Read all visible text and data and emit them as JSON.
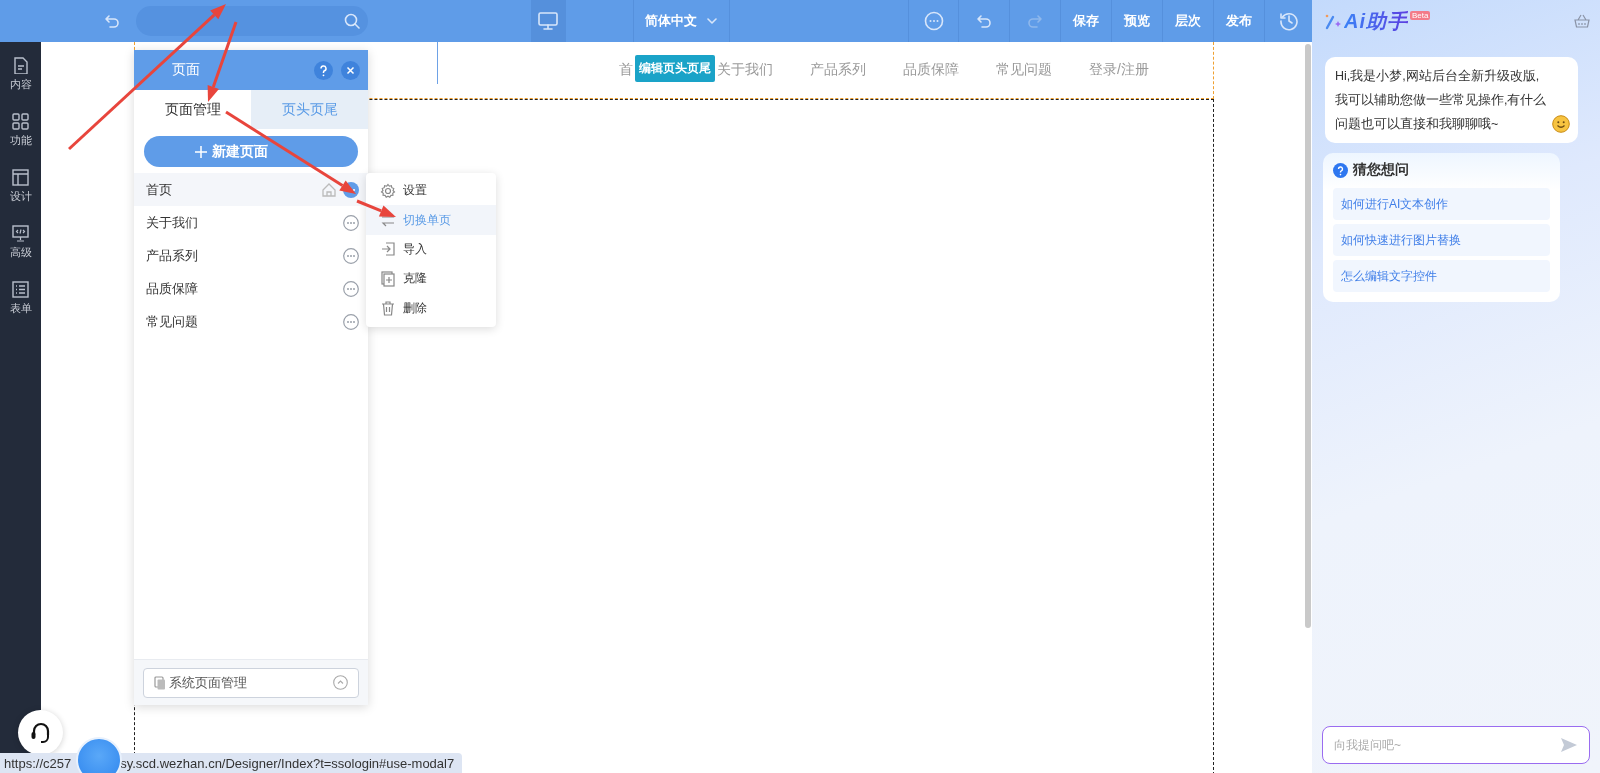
{
  "toolbar": {
    "language": "简体中文",
    "actions": [
      "保存",
      "预览",
      "层次",
      "发布"
    ]
  },
  "sidebar": {
    "items": [
      {
        "label": "内容",
        "kind": "content"
      },
      {
        "label": "功能",
        "kind": "function"
      },
      {
        "label": "设计",
        "kind": "design"
      },
      {
        "label": "高级",
        "kind": "advanced"
      },
      {
        "label": "表单",
        "kind": "form"
      }
    ]
  },
  "canvas": {
    "nav": [
      "首",
      "关于我们",
      "产品系列",
      "品质保障",
      "常见问题",
      "登录/注册"
    ],
    "edit_badge": "编辑页头页尾"
  },
  "page_panel": {
    "title": "页面",
    "tabs": [
      {
        "label": "页面管理",
        "selected": true
      },
      {
        "label": "页头页尾",
        "selected": false
      }
    ],
    "new_button": "新建页面",
    "pages": [
      {
        "label": "首页",
        "selected": true,
        "home": true
      },
      {
        "label": "关于我们",
        "selected": false,
        "home": false
      },
      {
        "label": "产品系列",
        "selected": false,
        "home": false
      },
      {
        "label": "品质保障",
        "selected": false,
        "home": false
      },
      {
        "label": "常见问题",
        "selected": false,
        "home": false
      }
    ],
    "footer_button": "系统页面管理"
  },
  "context_menu": {
    "items": [
      {
        "label": "设置",
        "kind": "settings",
        "selected": false
      },
      {
        "label": "切换单页",
        "kind": "switch",
        "selected": true
      },
      {
        "label": "导入",
        "kind": "import",
        "selected": false
      },
      {
        "label": "克隆",
        "kind": "clone",
        "selected": false
      },
      {
        "label": "删除",
        "kind": "delete",
        "selected": false
      }
    ]
  },
  "ai_panel": {
    "title": "Ai助手",
    "badge": "Beta",
    "greeting": "Hi,我是小梦,网站后台全新升级改版,我可以辅助您做一些常见操作,有什么问题也可以直接和我聊聊哦~",
    "suggest_title": "猜您想问",
    "suggestions": [
      "如何进行AI文本创作",
      "如何快速进行图片替换",
      "怎么编辑文字控件"
    ],
    "input": {
      "placeholder": "向我提问吧~"
    }
  },
  "status_bar": {
    "url_parts": [
      "https://c257",
      "sy.scd.wezhan.cn/Designer/Index?t=ssologin#use-modal7"
    ]
  }
}
